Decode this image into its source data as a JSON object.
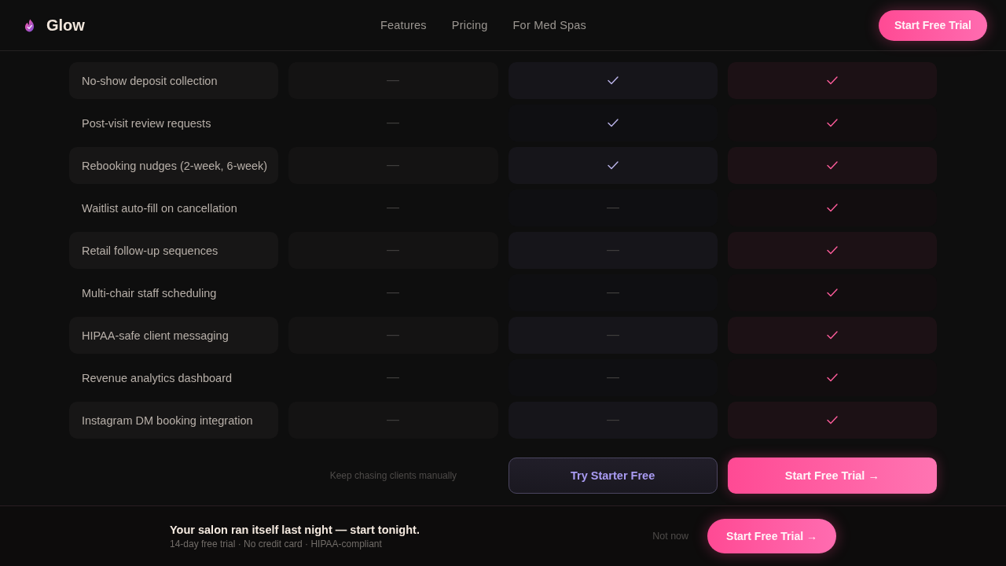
{
  "header": {
    "brand": "Glow",
    "nav": [
      "Features",
      "Pricing",
      "For Med Spas"
    ],
    "cta": "Start Free Trial"
  },
  "comparison": {
    "rows": [
      {
        "feature": "No-show deposit collection",
        "cells": [
          {
            "included": false
          },
          {
            "included": true
          },
          {
            "included": true
          }
        ]
      },
      {
        "feature": "Post-visit review requests",
        "cells": [
          {
            "included": false
          },
          {
            "included": true
          },
          {
            "included": true
          }
        ]
      },
      {
        "feature": "Rebooking nudges (2-week, 6-week)",
        "cells": [
          {
            "included": false
          },
          {
            "included": true
          },
          {
            "included": true
          }
        ]
      },
      {
        "feature": "Waitlist auto-fill on cancellation",
        "cells": [
          {
            "included": false
          },
          {
            "included": false
          },
          {
            "included": true
          }
        ]
      },
      {
        "feature": "Retail follow-up sequences",
        "cells": [
          {
            "included": false
          },
          {
            "included": false
          },
          {
            "included": true
          }
        ]
      },
      {
        "feature": "Multi-chair staff scheduling",
        "cells": [
          {
            "included": false
          },
          {
            "included": false
          },
          {
            "included": true
          }
        ]
      },
      {
        "feature": "HIPAA-safe client messaging",
        "cells": [
          {
            "included": false
          },
          {
            "included": false
          },
          {
            "included": true
          }
        ]
      },
      {
        "feature": "Revenue analytics dashboard",
        "cells": [
          {
            "included": false
          },
          {
            "included": false
          },
          {
            "included": true
          }
        ]
      },
      {
        "feature": "Instagram DM booking integration",
        "cells": [
          {
            "included": false
          },
          {
            "included": false
          },
          {
            "included": true
          }
        ]
      }
    ],
    "actions": [
      {
        "kind": "note",
        "label": "Keep chasing clients manually"
      },
      {
        "kind": "secondary",
        "label": "Try Starter Free"
      },
      {
        "kind": "primary",
        "label": "Start Free Trial →"
      }
    ]
  },
  "sticky_bar": {
    "title": "Your salon ran itself last night — start tonight.",
    "subtitle": "14-day free trial · No credit card · HIPAA-compliant",
    "dismiss": "Not now",
    "cta": "Start Free Trial →"
  }
}
